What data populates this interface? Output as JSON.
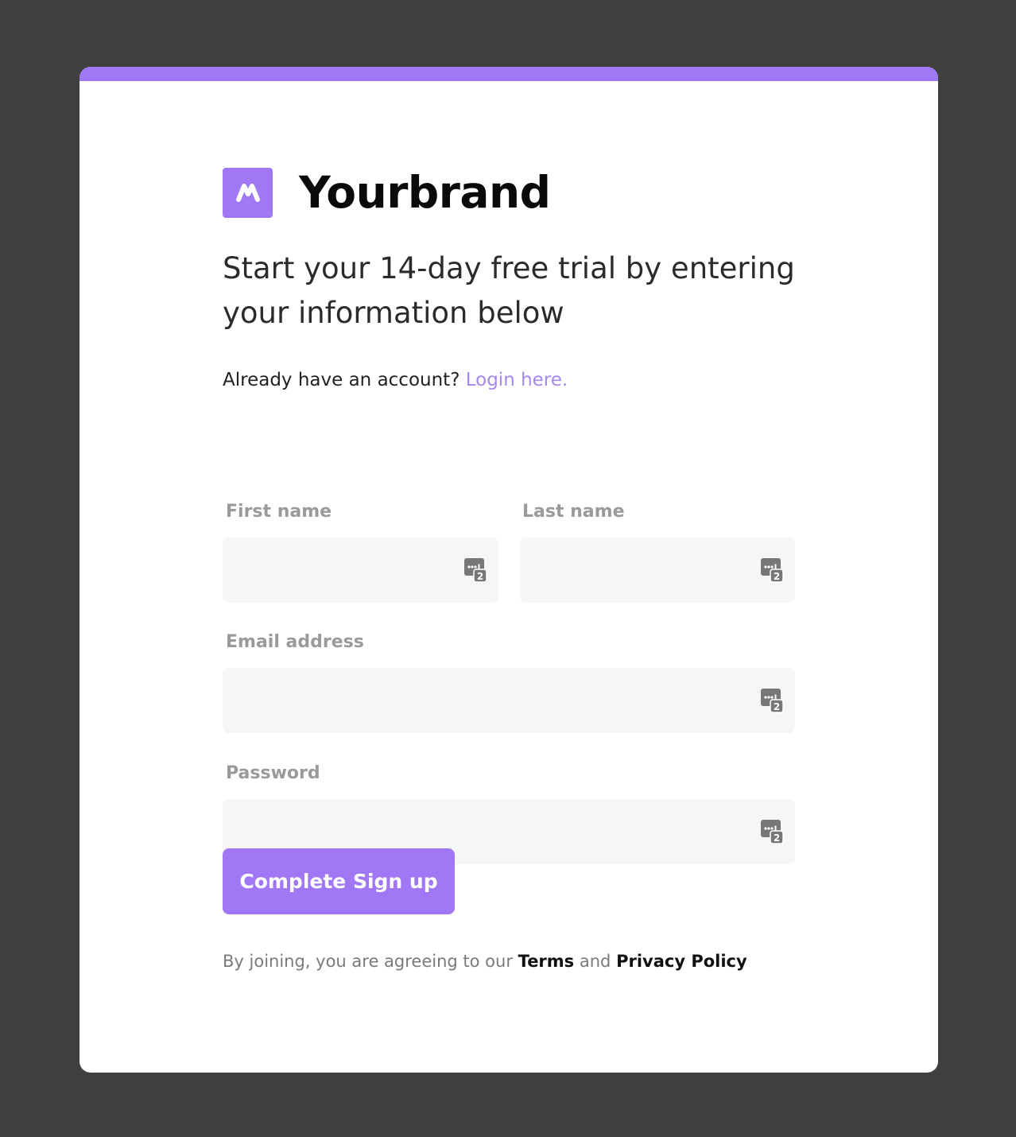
{
  "brand": {
    "name": "Yourbrand",
    "logo_icon": "brand-m-logo",
    "accent_color": "#a078f5"
  },
  "headline": "Start your 14-day free trial by entering your information below",
  "login": {
    "prompt": "Already have an account?",
    "link_text": "Login here."
  },
  "fields": {
    "first_name": {
      "label": "First name",
      "value": ""
    },
    "last_name": {
      "label": "Last name",
      "value": ""
    },
    "email": {
      "label": "Email address",
      "value": ""
    },
    "password": {
      "label": "Password",
      "value": ""
    },
    "autofill_icon": "password-manager-icon"
  },
  "submit": {
    "label": "Complete Sign up"
  },
  "legal": {
    "prefix": "By joining, you are agreeing to our",
    "terms": "Terms",
    "and": "and",
    "privacy": "Privacy Policy"
  },
  "colors": {
    "background": "#3f3f3f",
    "card": "#ffffff",
    "field_bg": "#f6f6f6",
    "label": "#9a9a9a",
    "link": "#a688ec"
  }
}
